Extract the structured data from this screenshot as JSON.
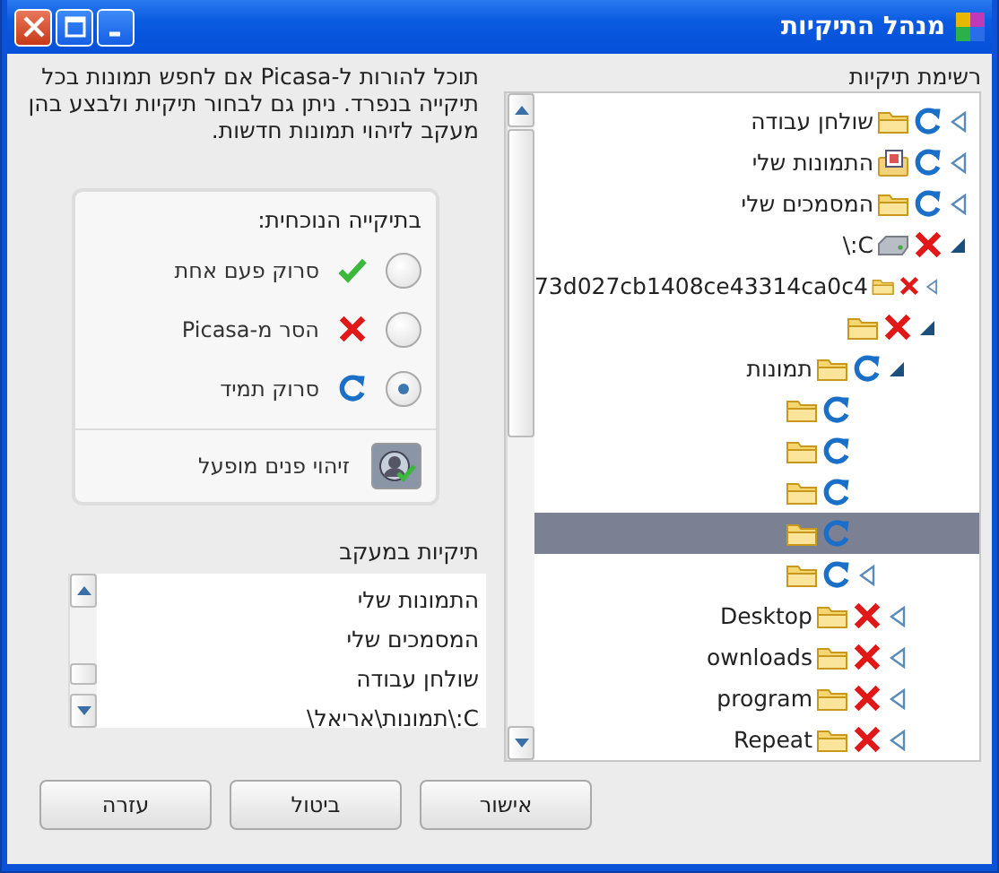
{
  "window": {
    "title": "מנהל התיקיות"
  },
  "folder_list": {
    "title": "רשימת תיקיות",
    "items": [
      {
        "label": "שולחן עבודה",
        "kind": "folder",
        "removed": false,
        "expanded": false
      },
      {
        "label": "התמונות שלי",
        "kind": "pictures",
        "removed": false,
        "expanded": false
      },
      {
        "label": "המסמכים שלי",
        "kind": "folder",
        "removed": false,
        "expanded": false
      },
      {
        "label": "C:\\",
        "kind": "drive",
        "removed": true,
        "expanded": true,
        "children": [
          {
            "label": "73d027cb1408ce43314ca0c4",
            "kind": "folder",
            "removed": true,
            "expanded": false
          },
          {
            "kind": "folder",
            "removed": true,
            "expanded": true,
            "children": [
              {
                "label": "תמונות",
                "kind": "folder",
                "removed": false,
                "expanded": true,
                "children": [
                  {
                    "kind": "folder",
                    "removed": false,
                    "selected": false
                  },
                  {
                    "kind": "folder",
                    "removed": false,
                    "selected": false
                  },
                  {
                    "kind": "folder",
                    "removed": false,
                    "selected": false
                  },
                  {
                    "kind": "folder",
                    "removed": false,
                    "selected": true
                  },
                  {
                    "kind": "folder",
                    "removed": false,
                    "expanded": false,
                    "selected": false
                  }
                ]
              },
              {
                "label": "Desktop",
                "kind": "folder",
                "removed": true,
                "expanded": false
              },
              {
                "label": "ownloads",
                "kind": "folder",
                "removed": true,
                "expanded": false
              },
              {
                "label": "program",
                "kind": "folder",
                "removed": true,
                "expanded": false
              },
              {
                "label": "Repeat",
                "kind": "folder",
                "removed": true,
                "expanded": false
              }
            ]
          }
        ]
      }
    ]
  },
  "description": "תוכל להורות ל-Picasa אם לחפש תמונות בכל תיקייה בנפרד. ניתן גם לבחור תיקיות ולבצע בהן מעקב לזיהוי תמונות חדשות.",
  "current_folder": {
    "title": "בתיקייה הנוכחית:",
    "options": [
      {
        "label": "סרוק פעם אחת",
        "kind": "scan_once",
        "selected": false
      },
      {
        "label": "הסר מ-Picasa",
        "kind": "remove",
        "selected": false
      },
      {
        "label": "סרוק תמיד",
        "kind": "scan_always",
        "selected": true
      }
    ],
    "face_detection": {
      "label": "זיהוי פנים מופעל",
      "on": true
    }
  },
  "watched_folders": {
    "title": "תיקיות במעקב",
    "items": [
      "התמונות שלי",
      "המסמכים שלי",
      "שולחן עבודה",
      "C:\\תמונות\\אריאל\\"
    ]
  },
  "buttons": [
    "אישור",
    "ביטול",
    "עזרה"
  ]
}
